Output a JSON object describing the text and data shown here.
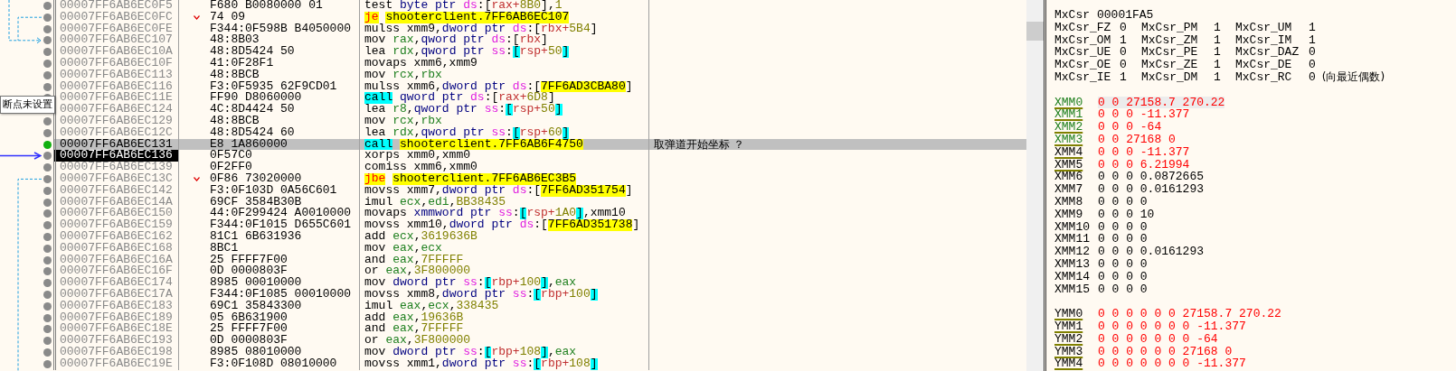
{
  "tooltip": "断点未设置",
  "rows": [
    {
      "address": "00007FF6AB6EC0F5",
      "bytes": "F680 B0080000 01",
      "jump_mark": false,
      "breakpoint": false,
      "highlighted": false,
      "current": false,
      "tokens": [
        {
          "kind": "op",
          "text": "test "
        },
        {
          "kind": "ptr",
          "text": "byte ptr "
        },
        {
          "kind": "seg",
          "text": "ds"
        },
        {
          "kind": "p",
          "text": ":["
        },
        {
          "kind": "mreg",
          "text": "rax+"
        },
        {
          "kind": "num",
          "text": "8B0"
        },
        {
          "kind": "p",
          "text": "],"
        },
        {
          "kind": "num",
          "text": "1"
        }
      ]
    },
    {
      "address": "00007FF6AB6EC0FC",
      "bytes": "74 09",
      "jump_mark": true,
      "breakpoint": false,
      "highlighted": false,
      "current": false,
      "tokens": [
        {
          "kind": "jcc",
          "text": "je"
        },
        {
          "kind": "label",
          "text": "shooterclient.7FF6AB6EC107"
        }
      ]
    },
    {
      "address": "00007FF6AB6EC0FE",
      "bytes": "F344:0F598B B4050000",
      "jump_mark": false,
      "breakpoint": false,
      "highlighted": false,
      "current": false,
      "tokens": [
        {
          "kind": "op",
          "text": "mulss "
        },
        {
          "kind": "p",
          "text": "xmm9,"
        },
        {
          "kind": "ptr",
          "text": "dword ptr "
        },
        {
          "kind": "seg",
          "text": "ds"
        },
        {
          "kind": "p",
          "text": ":["
        },
        {
          "kind": "mreg",
          "text": "rbx+"
        },
        {
          "kind": "num",
          "text": "5B4"
        },
        {
          "kind": "p",
          "text": "]"
        }
      ]
    },
    {
      "address": "00007FF6AB6EC107",
      "bytes": "48:8B03",
      "jump_mark": false,
      "breakpoint": false,
      "highlighted": false,
      "current": false,
      "tokens": [
        {
          "kind": "op",
          "text": "mov "
        },
        {
          "kind": "reg",
          "text": "rax"
        },
        {
          "kind": "p",
          "text": ","
        },
        {
          "kind": "ptr",
          "text": "qword ptr "
        },
        {
          "kind": "seg",
          "text": "ds"
        },
        {
          "kind": "p",
          "text": ":["
        },
        {
          "kind": "mreg",
          "text": "rbx"
        },
        {
          "kind": "p",
          "text": "]"
        }
      ]
    },
    {
      "address": "00007FF6AB6EC10A",
      "bytes": "48:8D5424 50",
      "jump_mark": false,
      "breakpoint": false,
      "highlighted": false,
      "current": false,
      "tokens": [
        {
          "kind": "op",
          "text": "lea "
        },
        {
          "kind": "reg",
          "text": "rdx"
        },
        {
          "kind": "p",
          "text": ","
        },
        {
          "kind": "ptr",
          "text": "qword ptr "
        },
        {
          "kind": "seg",
          "text": "ss"
        },
        {
          "kind": "p",
          "text": ":"
        },
        {
          "kind": "sb",
          "text": "["
        },
        {
          "kind": "mreg",
          "text": "rsp+"
        },
        {
          "kind": "num",
          "text": "50"
        },
        {
          "kind": "sb",
          "text": "]"
        }
      ]
    },
    {
      "address": "00007FF6AB6EC10F",
      "bytes": "41:0F28F1",
      "jump_mark": false,
      "breakpoint": false,
      "highlighted": false,
      "current": false,
      "tokens": [
        {
          "kind": "op",
          "text": "movaps "
        },
        {
          "kind": "p",
          "text": "xmm6,xmm9"
        }
      ]
    },
    {
      "address": "00007FF6AB6EC113",
      "bytes": "48:8BCB",
      "jump_mark": false,
      "breakpoint": false,
      "highlighted": false,
      "current": false,
      "tokens": [
        {
          "kind": "op",
          "text": "mov "
        },
        {
          "kind": "reg",
          "text": "rcx"
        },
        {
          "kind": "p",
          "text": ","
        },
        {
          "kind": "reg",
          "text": "rbx"
        }
      ]
    },
    {
      "address": "00007FF6AB6EC116",
      "bytes": "F3:0F5935 62F9CD01",
      "jump_mark": false,
      "breakpoint": false,
      "highlighted": false,
      "current": false,
      "tokens": [
        {
          "kind": "op",
          "text": "mulss "
        },
        {
          "kind": "p",
          "text": "xmm6,"
        },
        {
          "kind": "ptr",
          "text": "dword ptr "
        },
        {
          "kind": "seg",
          "text": "ds"
        },
        {
          "kind": "p",
          "text": ":["
        },
        {
          "kind": "label",
          "text": "7FF6AD3CBA80"
        },
        {
          "kind": "p",
          "text": "]"
        }
      ]
    },
    {
      "address": "00007FF6AB6EC11E",
      "bytes": "FF90 D8060000",
      "jump_mark": false,
      "breakpoint": false,
      "highlighted": false,
      "current": false,
      "tokens": [
        {
          "kind": "call",
          "text": "call"
        },
        {
          "kind": "ptr",
          "text": "qword ptr "
        },
        {
          "kind": "seg",
          "text": "ds"
        },
        {
          "kind": "p",
          "text": ":["
        },
        {
          "kind": "mreg",
          "text": "rax+"
        },
        {
          "kind": "num",
          "text": "6D8"
        },
        {
          "kind": "p",
          "text": "]"
        }
      ]
    },
    {
      "address": "00007FF6AB6EC124",
      "bytes": "4C:8D4424 50",
      "jump_mark": false,
      "highlighted": false,
      "current": false,
      "tokens": [
        {
          "kind": "op",
          "text": "lea "
        },
        {
          "kind": "reg",
          "text": "r8"
        },
        {
          "kind": "p",
          "text": ","
        },
        {
          "kind": "ptr",
          "text": "qword ptr "
        },
        {
          "kind": "seg",
          "text": "ss"
        },
        {
          "kind": "p",
          "text": ":"
        },
        {
          "kind": "sb",
          "text": "["
        },
        {
          "kind": "mreg",
          "text": "rsp+"
        },
        {
          "kind": "num",
          "text": "50"
        },
        {
          "kind": "sb",
          "text": "]"
        }
      ]
    },
    {
      "address": "00007FF6AB6EC129",
      "bytes": "48:8BCB",
      "jump_mark": false,
      "breakpoint": false,
      "highlighted": false,
      "current": false,
      "tokens": [
        {
          "kind": "op",
          "text": "mov "
        },
        {
          "kind": "reg",
          "text": "rcx"
        },
        {
          "kind": "p",
          "text": ","
        },
        {
          "kind": "reg",
          "text": "rbx"
        }
      ]
    },
    {
      "address": "00007FF6AB6EC12C",
      "bytes": "48:8D5424 60",
      "jump_mark": false,
      "breakpoint": false,
      "highlighted": false,
      "current": false,
      "tokens": [
        {
          "kind": "op",
          "text": "lea "
        },
        {
          "kind": "reg",
          "text": "rdx"
        },
        {
          "kind": "p",
          "text": ","
        },
        {
          "kind": "ptr",
          "text": "qword ptr "
        },
        {
          "kind": "seg",
          "text": "ss"
        },
        {
          "kind": "p",
          "text": ":"
        },
        {
          "kind": "sb",
          "text": "["
        },
        {
          "kind": "mreg",
          "text": "rsp+"
        },
        {
          "kind": "num",
          "text": "60"
        },
        {
          "kind": "sb",
          "text": "]"
        }
      ]
    },
    {
      "address": "00007FF6AB6EC131",
      "bytes": "E8 1A860000",
      "jump_mark": false,
      "breakpoint": true,
      "highlighted": true,
      "current": false,
      "comment": "取弹道开始坐标 ？",
      "tokens": [
        {
          "kind": "call",
          "text": "call"
        },
        {
          "kind": "label",
          "text": "shooterclient.7FF6AB6F4750"
        }
      ]
    },
    {
      "address": "00007FF6AB6EC136",
      "bytes": "0F57C0",
      "jump_mark": false,
      "breakpoint": false,
      "highlighted": false,
      "current": true,
      "tokens": [
        {
          "kind": "op",
          "text": "xorps "
        },
        {
          "kind": "p",
          "text": "xmm0,xmm0"
        }
      ]
    },
    {
      "address": "00007FF6AB6EC139",
      "bytes": "0F2FF0",
      "jump_mark": false,
      "breakpoint": false,
      "highlighted": false,
      "current": false,
      "tokens": [
        {
          "kind": "op",
          "text": "comiss "
        },
        {
          "kind": "p",
          "text": "xmm6,xmm0"
        }
      ]
    },
    {
      "address": "00007FF6AB6EC13C",
      "bytes": "0F86 73020000",
      "jump_mark": true,
      "breakpoint": false,
      "highlighted": false,
      "current": false,
      "tokens": [
        {
          "kind": "jcc",
          "text": "jbe"
        },
        {
          "kind": "label",
          "text": "shooterclient.7FF6AB6EC3B5"
        }
      ]
    },
    {
      "address": "00007FF6AB6EC142",
      "bytes": "F3:0F103D 0A56C601",
      "jump_mark": false,
      "breakpoint": false,
      "highlighted": false,
      "current": false,
      "tokens": [
        {
          "kind": "op",
          "text": "movss "
        },
        {
          "kind": "p",
          "text": "xmm7,"
        },
        {
          "kind": "ptr",
          "text": "dword ptr "
        },
        {
          "kind": "seg",
          "text": "ds"
        },
        {
          "kind": "p",
          "text": ":["
        },
        {
          "kind": "label",
          "text": "7FF6AD351754"
        },
        {
          "kind": "p",
          "text": "]"
        }
      ]
    },
    {
      "address": "00007FF6AB6EC14A",
      "bytes": "69CF 3584B30B",
      "jump_mark": false,
      "breakpoint": false,
      "highlighted": false,
      "current": false,
      "tokens": [
        {
          "kind": "op",
          "text": "imul "
        },
        {
          "kind": "reg",
          "text": "ecx"
        },
        {
          "kind": "p",
          "text": ","
        },
        {
          "kind": "reg",
          "text": "edi"
        },
        {
          "kind": "p",
          "text": ","
        },
        {
          "kind": "num",
          "text": "BB38435"
        }
      ]
    },
    {
      "address": "00007FF6AB6EC150",
      "bytes": "44:0F299424 A0010000",
      "jump_mark": false,
      "breakpoint": false,
      "highlighted": false,
      "current": false,
      "tokens": [
        {
          "kind": "op",
          "text": "movaps "
        },
        {
          "kind": "ptr",
          "text": "xmmword ptr "
        },
        {
          "kind": "seg",
          "text": "ss"
        },
        {
          "kind": "p",
          "text": ":"
        },
        {
          "kind": "sb",
          "text": "["
        },
        {
          "kind": "mreg",
          "text": "rsp+"
        },
        {
          "kind": "num",
          "text": "1A0"
        },
        {
          "kind": "sb",
          "text": "]"
        },
        {
          "kind": "p",
          "text": ",xmm10"
        }
      ]
    },
    {
      "address": "00007FF6AB6EC159",
      "bytes": "F344:0F1015 D655C601",
      "jump_mark": false,
      "breakpoint": false,
      "highlighted": false,
      "current": false,
      "tokens": [
        {
          "kind": "op",
          "text": "movss "
        },
        {
          "kind": "p",
          "text": "xmm10,"
        },
        {
          "kind": "ptr",
          "text": "dword ptr "
        },
        {
          "kind": "seg",
          "text": "ds"
        },
        {
          "kind": "p",
          "text": ":["
        },
        {
          "kind": "label",
          "text": "7FF6AD351738"
        },
        {
          "kind": "p",
          "text": "]"
        }
      ]
    },
    {
      "address": "00007FF6AB6EC162",
      "bytes": "81C1 6B631936",
      "jump_mark": false,
      "breakpoint": false,
      "highlighted": false,
      "current": false,
      "tokens": [
        {
          "kind": "op",
          "text": "add "
        },
        {
          "kind": "reg",
          "text": "ecx"
        },
        {
          "kind": "p",
          "text": ","
        },
        {
          "kind": "num",
          "text": "3619636B"
        }
      ]
    },
    {
      "address": "00007FF6AB6EC168",
      "bytes": "8BC1",
      "jump_mark": false,
      "breakpoint": false,
      "highlighted": false,
      "current": false,
      "tokens": [
        {
          "kind": "op",
          "text": "mov "
        },
        {
          "kind": "reg",
          "text": "eax"
        },
        {
          "kind": "p",
          "text": ","
        },
        {
          "kind": "reg",
          "text": "ecx"
        }
      ]
    },
    {
      "address": "00007FF6AB6EC16A",
      "bytes": "25 FFFF7F00",
      "jump_mark": false,
      "breakpoint": false,
      "highlighted": false,
      "current": false,
      "tokens": [
        {
          "kind": "op",
          "text": "and "
        },
        {
          "kind": "reg",
          "text": "eax"
        },
        {
          "kind": "p",
          "text": ","
        },
        {
          "kind": "num",
          "text": "7FFFFF"
        }
      ]
    },
    {
      "address": "00007FF6AB6EC16F",
      "bytes": "0D 0000803F",
      "jump_mark": false,
      "breakpoint": false,
      "highlighted": false,
      "current": false,
      "tokens": [
        {
          "kind": "op",
          "text": "or "
        },
        {
          "kind": "reg",
          "text": "eax"
        },
        {
          "kind": "p",
          "text": ","
        },
        {
          "kind": "num",
          "text": "3F800000"
        }
      ]
    },
    {
      "address": "00007FF6AB6EC174",
      "bytes": "8985 00010000",
      "jump_mark": false,
      "breakpoint": false,
      "highlighted": false,
      "current": false,
      "tokens": [
        {
          "kind": "op",
          "text": "mov "
        },
        {
          "kind": "ptr",
          "text": "dword ptr "
        },
        {
          "kind": "seg",
          "text": "ss"
        },
        {
          "kind": "p",
          "text": ":"
        },
        {
          "kind": "sb",
          "text": "["
        },
        {
          "kind": "mreg",
          "text": "rbp+"
        },
        {
          "kind": "num",
          "text": "100"
        },
        {
          "kind": "sb",
          "text": "]"
        },
        {
          "kind": "p",
          "text": ","
        },
        {
          "kind": "reg",
          "text": "eax"
        }
      ]
    },
    {
      "address": "00007FF6AB6EC17A",
      "bytes": "F344:0F1085 00010000",
      "jump_mark": false,
      "breakpoint": false,
      "highlighted": false,
      "current": false,
      "tokens": [
        {
          "kind": "op",
          "text": "movss "
        },
        {
          "kind": "p",
          "text": "xmm8,"
        },
        {
          "kind": "ptr",
          "text": "dword ptr "
        },
        {
          "kind": "seg",
          "text": "ss"
        },
        {
          "kind": "p",
          "text": ":"
        },
        {
          "kind": "sb",
          "text": "["
        },
        {
          "kind": "mreg",
          "text": "rbp+"
        },
        {
          "kind": "num",
          "text": "100"
        },
        {
          "kind": "sb",
          "text": "]"
        }
      ]
    },
    {
      "address": "00007FF6AB6EC183",
      "bytes": "69C1 35843300",
      "jump_mark": false,
      "breakpoint": false,
      "highlighted": false,
      "current": false,
      "tokens": [
        {
          "kind": "op",
          "text": "imul "
        },
        {
          "kind": "reg",
          "text": "eax"
        },
        {
          "kind": "p",
          "text": ","
        },
        {
          "kind": "reg",
          "text": "ecx"
        },
        {
          "kind": "p",
          "text": ","
        },
        {
          "kind": "num",
          "text": "338435"
        }
      ]
    },
    {
      "address": "00007FF6AB6EC189",
      "bytes": "05 6B631900",
      "jump_mark": false,
      "breakpoint": false,
      "highlighted": false,
      "current": false,
      "tokens": [
        {
          "kind": "op",
          "text": "add "
        },
        {
          "kind": "reg",
          "text": "eax"
        },
        {
          "kind": "p",
          "text": ","
        },
        {
          "kind": "num",
          "text": "19636B"
        }
      ]
    },
    {
      "address": "00007FF6AB6EC18E",
      "bytes": "25 FFFF7F00",
      "jump_mark": false,
      "breakpoint": false,
      "highlighted": false,
      "current": false,
      "tokens": [
        {
          "kind": "op",
          "text": "and "
        },
        {
          "kind": "reg",
          "text": "eax"
        },
        {
          "kind": "p",
          "text": ","
        },
        {
          "kind": "num",
          "text": "7FFFFF"
        }
      ]
    },
    {
      "address": "00007FF6AB6EC193",
      "bytes": "0D 0000803F",
      "jump_mark": false,
      "breakpoint": false,
      "highlighted": false,
      "current": false,
      "tokens": [
        {
          "kind": "op",
          "text": "or "
        },
        {
          "kind": "reg",
          "text": "eax"
        },
        {
          "kind": "p",
          "text": ","
        },
        {
          "kind": "num",
          "text": "3F800000"
        }
      ]
    },
    {
      "address": "00007FF6AB6EC198",
      "bytes": "8985 08010000",
      "jump_mark": false,
      "breakpoint": false,
      "highlighted": false,
      "current": false,
      "tokens": [
        {
          "kind": "op",
          "text": "mov "
        },
        {
          "kind": "ptr",
          "text": "dword ptr "
        },
        {
          "kind": "seg",
          "text": "ss"
        },
        {
          "kind": "p",
          "text": ":"
        },
        {
          "kind": "sb",
          "text": "["
        },
        {
          "kind": "mreg",
          "text": "rbp+"
        },
        {
          "kind": "num",
          "text": "108"
        },
        {
          "kind": "sb",
          "text": "]"
        },
        {
          "kind": "p",
          "text": ","
        },
        {
          "kind": "reg",
          "text": "eax"
        }
      ]
    },
    {
      "address": "00007FF6AB6EC19E",
      "bytes": "F3:0F108D 08010000",
      "jump_mark": false,
      "breakpoint": false,
      "highlighted": false,
      "current": false,
      "tokens": [
        {
          "kind": "op",
          "text": "movss "
        },
        {
          "kind": "p",
          "text": "xmm1,"
        },
        {
          "kind": "ptr",
          "text": "dword ptr "
        },
        {
          "kind": "seg",
          "text": "ss"
        },
        {
          "kind": "p",
          "text": ":"
        },
        {
          "kind": "sb",
          "text": "["
        },
        {
          "kind": "mreg",
          "text": "rbp+"
        },
        {
          "kind": "num",
          "text": "108"
        },
        {
          "kind": "sb",
          "text": "]"
        }
      ]
    }
  ],
  "mxcsr": {
    "name": "MxCsr",
    "value": "00001FA5"
  },
  "mxcsr_flags": [
    {
      "name": "MxCsr_FZ",
      "value": "0"
    },
    {
      "name": "MxCsr_PM",
      "value": "1"
    },
    {
      "name": "MxCsr_UM",
      "value": "1"
    },
    {
      "name": "MxCsr_OM",
      "value": "1"
    },
    {
      "name": "MxCsr_ZM",
      "value": "1"
    },
    {
      "name": "MxCsr_IM",
      "value": "1"
    },
    {
      "name": "MxCsr_UE",
      "value": "0"
    },
    {
      "name": "MxCsr_PE",
      "value": "1"
    },
    {
      "name": "MxCsr_DAZ",
      "value": "0"
    },
    {
      "name": "MxCsr_OE",
      "value": "0"
    },
    {
      "name": "MxCsr_ZE",
      "value": "1"
    },
    {
      "name": "MxCsr_DE",
      "value": "0"
    },
    {
      "name": "MxCsr_IE",
      "value": "1"
    },
    {
      "name": "MxCsr_DM",
      "value": "1"
    },
    {
      "name": "MxCsr_RC",
      "value": "0",
      "note": "(向最近偶数)"
    }
  ],
  "xmm_registers": [
    {
      "name": "XMM0",
      "value": "0 0 27158.7 270.22",
      "changed": true,
      "used": true,
      "underlined": true,
      "selected": true
    },
    {
      "name": "XMM1",
      "value": "0 0 0 -11.377",
      "changed": true,
      "used": true,
      "underlined": true,
      "selected": false
    },
    {
      "name": "XMM2",
      "value": "0 0 0 -64",
      "changed": true,
      "used": true,
      "underlined": true,
      "selected": false
    },
    {
      "name": "XMM3",
      "value": "0 0 27168 0",
      "changed": true,
      "used": true,
      "underlined": true,
      "selected": false
    },
    {
      "name": "XMM4",
      "value": "0 0 0 -11.377",
      "changed": true,
      "used": false,
      "underlined": true,
      "selected": false
    },
    {
      "name": "XMM5",
      "value": "0 0 0 6.21994",
      "changed": true,
      "used": false,
      "underlined": true,
      "selected": false
    },
    {
      "name": "XMM6",
      "value": "0 0 0 0.0872665",
      "changed": false,
      "used": false,
      "underlined": false,
      "selected": false
    },
    {
      "name": "XMM7",
      "value": "0 0 0 0.0161293",
      "changed": false,
      "used": false,
      "underlined": false,
      "selected": false
    },
    {
      "name": "XMM8",
      "value": "0 0 0 0",
      "changed": false,
      "used": false,
      "underlined": false,
      "selected": false
    },
    {
      "name": "XMM9",
      "value": "0 0 0 10",
      "changed": false,
      "used": false,
      "underlined": false,
      "selected": false
    },
    {
      "name": "XMM10",
      "value": "0 0 0 0",
      "changed": false,
      "used": false,
      "underlined": false,
      "selected": false
    },
    {
      "name": "XMM11",
      "value": "0 0 0 0",
      "changed": false,
      "used": false,
      "underlined": false,
      "selected": false
    },
    {
      "name": "XMM12",
      "value": "0 0 0 0.0161293",
      "changed": false,
      "used": false,
      "underlined": false,
      "selected": false
    },
    {
      "name": "XMM13",
      "value": "0 0 0 0",
      "changed": false,
      "used": false,
      "underlined": false,
      "selected": false
    },
    {
      "name": "XMM14",
      "value": "0 0 0 0",
      "changed": false,
      "used": false,
      "underlined": false,
      "selected": false
    },
    {
      "name": "XMM15",
      "value": "0 0 0 0",
      "changed": false,
      "used": false,
      "underlined": false,
      "selected": false
    }
  ],
  "ymm_registers": [
    {
      "name": "YMM0",
      "value": "0 0 0 0 0 0 27158.7 270.22",
      "changed": true,
      "used": false,
      "underlined": true,
      "selected": false
    },
    {
      "name": "YMM1",
      "value": "0 0 0 0 0 0 0 -11.377",
      "changed": true,
      "used": false,
      "underlined": true,
      "selected": false
    },
    {
      "name": "YMM2",
      "value": "0 0 0 0 0 0 0 -64",
      "changed": true,
      "used": false,
      "underlined": true,
      "selected": false
    },
    {
      "name": "YMM3",
      "value": "0 0 0 0 0 0 27168 0",
      "changed": true,
      "used": false,
      "underlined": true,
      "selected": false
    },
    {
      "name": "YMM4",
      "value": "0 0 0 0 0 0 0 -11.377",
      "changed": true,
      "used": false,
      "underlined": true,
      "selected": false
    }
  ]
}
